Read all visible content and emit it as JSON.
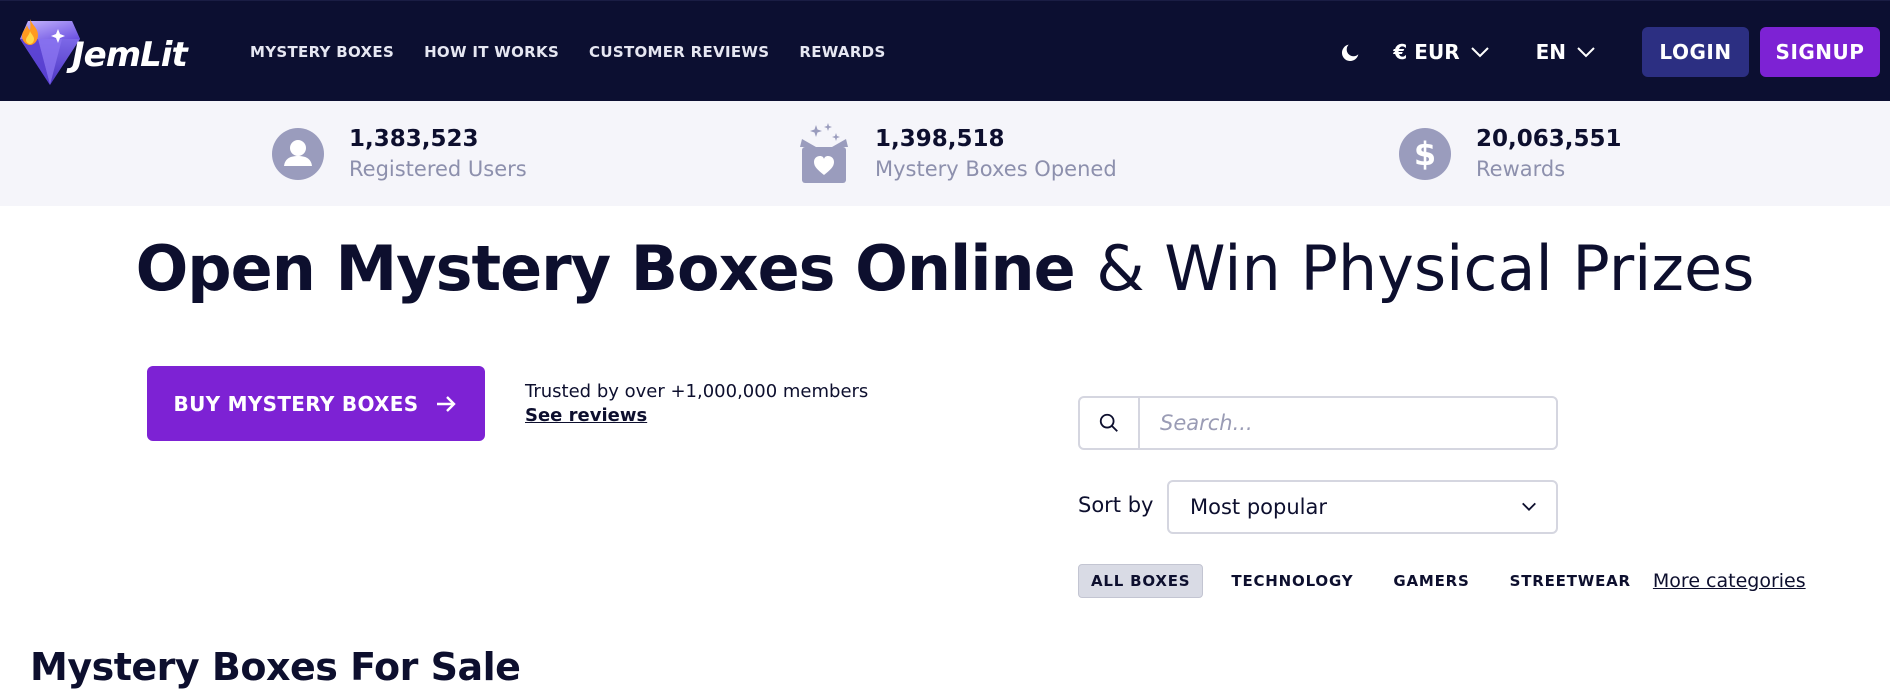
{
  "header": {
    "logo_text": "JemLit",
    "nav": [
      {
        "label": "MYSTERY BOXES"
      },
      {
        "label": "HOW IT WORKS"
      },
      {
        "label": "CUSTOMER REVIEWS"
      },
      {
        "label": "REWARDS"
      }
    ],
    "theme_icon": "moon-icon",
    "currency": "€ EUR",
    "language": "EN",
    "login_label": "LOGIN",
    "signup_label": "SIGNUP"
  },
  "stats": [
    {
      "value": "1,383,523",
      "label": "Registered Users",
      "icon": "user-icon"
    },
    {
      "value": "1,398,518",
      "label": "Mystery Boxes Opened",
      "icon": "gift-box-icon"
    },
    {
      "value": "20,063,551",
      "label": "Rewards",
      "icon": "dollar-icon"
    }
  ],
  "hero": {
    "title_strong": "Open Mystery Boxes Online",
    "title_light": "& Win Physical Prizes",
    "buy_label": "BUY MYSTERY BOXES",
    "trusted_text": "Trusted by over +1,000,000 members",
    "reviews_link": "See reviews"
  },
  "filters": {
    "search_placeholder": "Search...",
    "sort_label": "Sort by",
    "sort_value": "Most popular",
    "categories": [
      {
        "label": "ALL BOXES",
        "active": true
      },
      {
        "label": "TECHNOLOGY",
        "active": false
      },
      {
        "label": "GAMERS",
        "active": false
      },
      {
        "label": "STREETWEAR",
        "active": false
      }
    ],
    "more_categories": "More categories"
  },
  "section": {
    "title": "Mystery Boxes For Sale"
  },
  "colors": {
    "navbar_bg": "#0c0f31",
    "primary_purple": "#7d22d4",
    "login_bg": "#2c2f82",
    "stats_bg": "#f5f5fa",
    "text_dark": "#0d0f2e",
    "muted": "#8d90ad"
  }
}
